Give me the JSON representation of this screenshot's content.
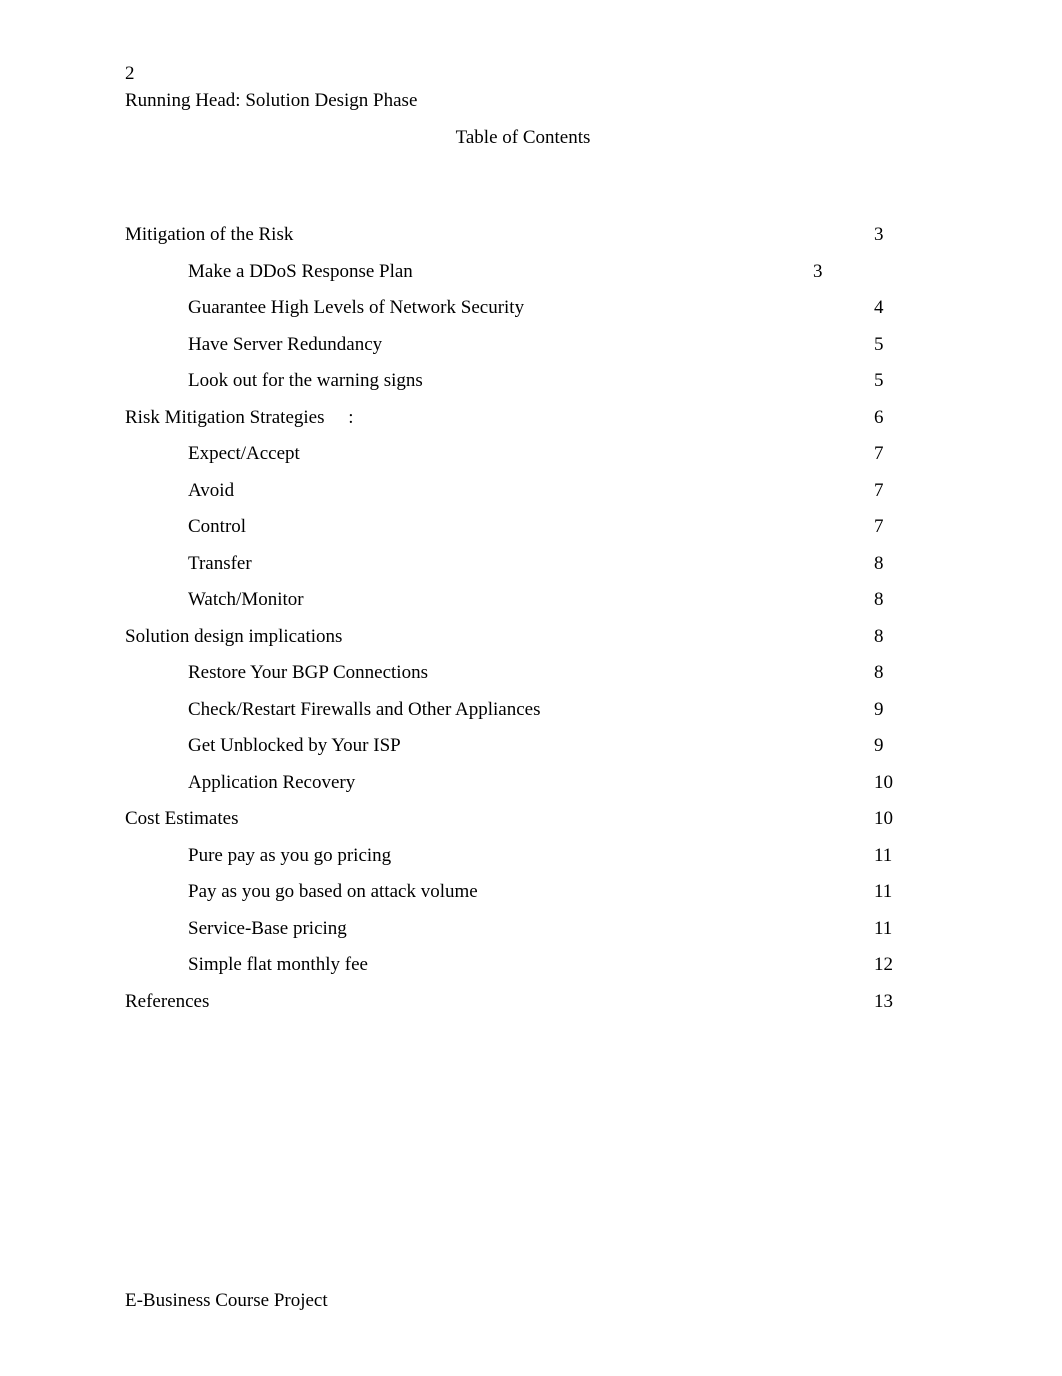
{
  "document": {
    "page_number_label": "2",
    "running_head": "Running Head: Solution Design Phase",
    "toc_title": "Table of Contents",
    "footer": "E-Business Course Project"
  },
  "toc": {
    "entries": [
      {
        "label": "Mitigation of the Risk",
        "page": "3",
        "level": 1,
        "short_tab": false
      },
      {
        "label": "Make a DDoS Response Plan",
        "page": "3",
        "level": 2,
        "short_tab": true
      },
      {
        "label": "Guarantee High Levels of Network Security",
        "page": "4",
        "level": 2,
        "short_tab": false
      },
      {
        "label": "Have Server Redundancy",
        "page": "5",
        "level": 2,
        "short_tab": false
      },
      {
        "label": "Look out for the warning signs",
        "page": "5",
        "level": 2,
        "short_tab": false
      },
      {
        "label": "Risk Mitigation Strategies     :",
        "page": "6",
        "level": 1,
        "short_tab": false
      },
      {
        "label": "Expect/Accept",
        "page": "7",
        "level": 2,
        "short_tab": false
      },
      {
        "label": "Avoid",
        "page": "7",
        "level": 2,
        "short_tab": false
      },
      {
        "label": "Control",
        "page": "7",
        "level": 2,
        "short_tab": false
      },
      {
        "label": "Transfer",
        "page": "8",
        "level": 2,
        "short_tab": false
      },
      {
        "label": "Watch/Monitor",
        "page": "8",
        "level": 2,
        "short_tab": false
      },
      {
        "label": "Solution design implications",
        "page": "8",
        "level": 1,
        "short_tab": false
      },
      {
        "label": "Restore Your BGP Connections",
        "page": "8",
        "level": 2,
        "short_tab": false
      },
      {
        "label": "Check/Restart Firewalls and Other Appliances",
        "page": "9",
        "level": 2,
        "short_tab": false
      },
      {
        "label": "Get Unblocked by Your ISP",
        "page": "9",
        "level": 2,
        "short_tab": false
      },
      {
        "label": "Application Recovery",
        "page": "10",
        "level": 2,
        "short_tab": false
      },
      {
        "label": "Cost Estimates",
        "page": "10",
        "level": 1,
        "short_tab": false
      },
      {
        "label": "Pure pay as you go pricing",
        "page": "11",
        "level": 2,
        "short_tab": false
      },
      {
        "label": "Pay as you go based on attack volume",
        "page": "11",
        "level": 2,
        "short_tab": false
      },
      {
        "label": "Service-Base pricing",
        "page": "11",
        "level": 2,
        "short_tab": false
      },
      {
        "label": "Simple flat monthly fee",
        "page": "12",
        "level": 2,
        "short_tab": false
      },
      {
        "label": "References",
        "page": "13",
        "level": 1,
        "short_tab": false
      }
    ]
  }
}
